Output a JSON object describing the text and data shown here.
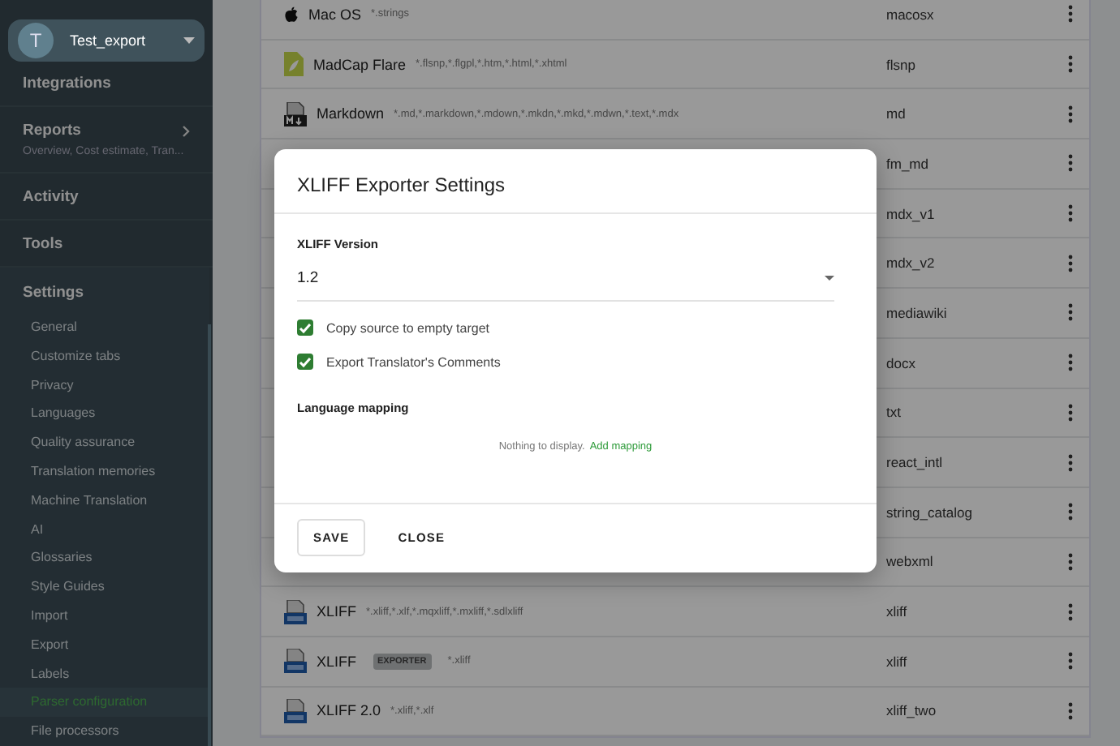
{
  "account": {
    "avatar_letter": "T",
    "name": "Test_export"
  },
  "sidebar": {
    "items": [
      {
        "label": "Integrations",
        "chevron": false
      },
      {
        "label": "Reports",
        "subtitle": "Overview, Cost estimate, Tran...",
        "chevron": true
      },
      {
        "label": "Activity",
        "chevron": false
      },
      {
        "label": "Tools",
        "chevron": false
      }
    ],
    "settings": {
      "label": "Settings",
      "children": [
        {
          "label": "General",
          "selected": false
        },
        {
          "label": "Customize tabs",
          "selected": false
        },
        {
          "label": "Privacy",
          "selected": false
        },
        {
          "label": "Languages",
          "selected": false
        },
        {
          "label": "Quality assurance",
          "selected": false
        },
        {
          "label": "Translation memories",
          "selected": false
        },
        {
          "label": "Machine Translation",
          "selected": false
        },
        {
          "label": "AI",
          "selected": false
        },
        {
          "label": "Glossaries",
          "selected": false
        },
        {
          "label": "Style Guides",
          "selected": false
        },
        {
          "label": "Import",
          "selected": false
        },
        {
          "label": "Export",
          "selected": false
        },
        {
          "label": "Labels",
          "selected": false
        },
        {
          "label": "Parser configuration",
          "selected": true
        },
        {
          "label": "File processors",
          "selected": false
        }
      ]
    }
  },
  "table": {
    "rows": [
      {
        "kind": "apple",
        "name": "Mac OS",
        "badge": null,
        "extensions": "*.strings",
        "code": "macosx"
      },
      {
        "kind": "madcap",
        "name": "MadCap Flare",
        "badge": null,
        "extensions": "*.flsnp,*.flgpl,*.htm,*.html,*.xhtml",
        "code": "flsnp"
      },
      {
        "kind": "markdown",
        "name": "Markdown",
        "badge": null,
        "extensions": "*.md,*.markdown,*.mdown,*.mkdn,*.mkd,*.mdwn,*.text,*.mdx",
        "code": "md"
      },
      {
        "kind": "hidden",
        "code": "fm_md"
      },
      {
        "kind": "hidden",
        "code": "mdx_v1"
      },
      {
        "kind": "hidden",
        "code": "mdx_v2"
      },
      {
        "kind": "hidden",
        "code": "mediawiki"
      },
      {
        "kind": "hidden",
        "code": "docx"
      },
      {
        "kind": "hidden",
        "code": "txt"
      },
      {
        "kind": "hidden",
        "code": "react_intl"
      },
      {
        "kind": "hidden",
        "code": "string_catalog"
      },
      {
        "kind": "hidden",
        "code": "webxml"
      },
      {
        "kind": "xliff",
        "name": "XLIFF",
        "badge": null,
        "extensions": "*.xliff,*.xlf,*.mqxliff,*.mxliff,*.sdlxliff",
        "code": "xliff"
      },
      {
        "kind": "xliff",
        "name": "XLIFF",
        "badge": "EXPORTER",
        "extensions": "*.xliff",
        "code": "xliff"
      },
      {
        "kind": "xliff",
        "name": "XLIFF 2.0",
        "badge": null,
        "extensions": "*.xliff,*.xlf",
        "code": "xliff_two"
      }
    ]
  },
  "dialog": {
    "title": "XLIFF Exporter Settings",
    "version_field": {
      "label": "XLIFF Version",
      "value": "1.2"
    },
    "checkboxes": [
      {
        "label": "Copy source to empty target",
        "checked": true
      },
      {
        "label": "Export Translator's Comments",
        "checked": true
      }
    ],
    "mapping_heading": "Language mapping",
    "empty_text": "Nothing to display.",
    "add_link": "Add mapping",
    "buttons": [
      {
        "label": "SAVE",
        "kind": "outlined"
      },
      {
        "label": "CLOSE",
        "kind": "text"
      }
    ]
  }
}
